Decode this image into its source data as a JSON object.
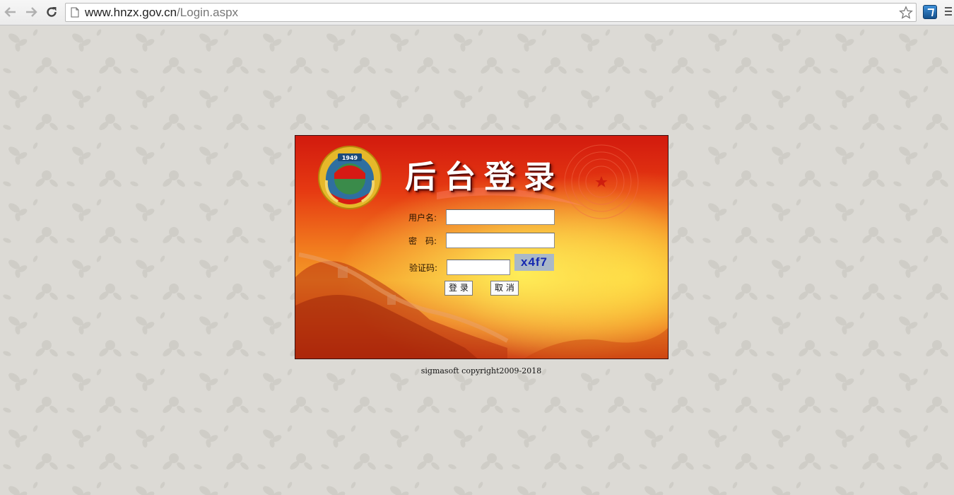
{
  "browser": {
    "url_host": "www.hnzx.gov.cn",
    "url_path": "/Login.aspx",
    "back_icon": "back-arrow-icon",
    "forward_icon": "forward-arrow-icon",
    "reload_icon": "reload-icon",
    "bookmark_icon": "star-icon",
    "menu_icon": "hamburger-menu-icon"
  },
  "login": {
    "title": "后台登录",
    "username_label": "用户名:",
    "username_value": "",
    "password_label": "密　码:",
    "password_value": "",
    "captcha_label": "验证码:",
    "captcha_value": "",
    "captcha_code": "x4f7",
    "login_button": "登 录",
    "cancel_button": "取 消"
  },
  "footer": {
    "copyright": "sigmasoft copyright2009-2018"
  },
  "colors": {
    "page_background": "#dcdad5",
    "panel_red": "#d21a0e",
    "panel_yellow": "#f5d23a",
    "captcha_bg": "#a9b8c8",
    "captcha_text": "#1428b0"
  }
}
